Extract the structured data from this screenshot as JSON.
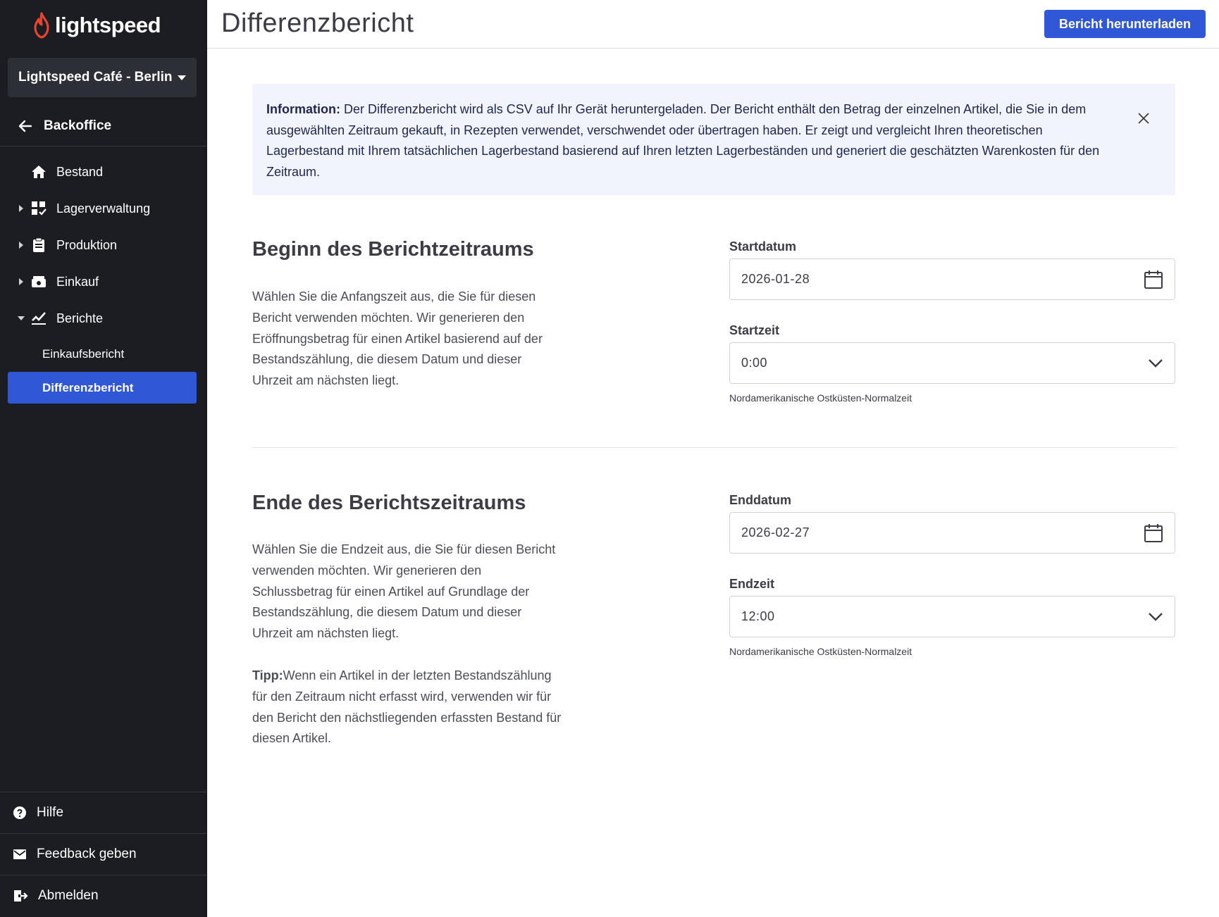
{
  "sidebar": {
    "logo_text": "lightspeed",
    "store_name": "Lightspeed Café - Berlin",
    "backoffice_label": "Backoffice",
    "nav": [
      {
        "label": "Bestand",
        "icon": "home-icon"
      },
      {
        "label": "Lagerverwaltung",
        "icon": "inventory-grid-icon"
      },
      {
        "label": "Produktion",
        "icon": "clipboard-icon"
      },
      {
        "label": "Einkauf",
        "icon": "cash-icon"
      },
      {
        "label": "Berichte",
        "icon": "chart-icon"
      }
    ],
    "sub_items": [
      "Einkaufsbericht",
      "Differenzbericht"
    ],
    "bottom": {
      "help": "Hilfe",
      "feedback": "Feedback geben",
      "logout": "Abmelden"
    }
  },
  "header": {
    "title": "Differenzbericht",
    "download_label": "Bericht herunterladen"
  },
  "info": {
    "prefix": "Information:",
    "text": " Der Differenzbericht wird als CSV auf Ihr Gerät heruntergeladen. Der Bericht enthält den Betrag der einzelnen Artikel, die Sie in dem ausgewählten Zeitraum gekauft, in Rezepten verwendet, verschwendet oder übertragen haben. Er zeigt und vergleicht Ihren theoretischen Lagerbestand mit Ihrem tatsächlichen Lagerbestand basierend auf Ihren letzten Lagerbeständen und generiert die geschätzten Warenkosten für den Zeitraum."
  },
  "start": {
    "title": "Beginn des Berichtzeitraums",
    "description": "Wählen Sie die Anfangszeit aus, die Sie für diesen Bericht verwenden möchten. Wir generieren den Eröffnungsbetrag für einen Artikel basierend auf der Bestandszählung, die diesem Datum und dieser Uhrzeit am nächsten liegt.",
    "date_label": "Startdatum",
    "date_value": "2026-01-28",
    "time_label": "Startzeit",
    "time_value": "0:00",
    "timezone": "Nordamerikanische Ostküsten-Normalzeit"
  },
  "end": {
    "title": "Ende des Berichtszeitraums",
    "description": "Wählen Sie die Endzeit aus, die Sie für diesen Bericht verwenden möchten. Wir generieren den Schlussbetrag für einen Artikel auf Grundlage der Bestandszählung, die diesem Datum und dieser Uhrzeit am nächsten liegt.",
    "tip_prefix": "Tipp:",
    "tip_text": "Wenn ein Artikel in der letzten Bestandszählung für den Zeitraum nicht erfasst wird, verwenden wir für den Bericht den nächstliegenden erfassten Bestand für diesen Artikel.",
    "date_label": "Enddatum",
    "date_value": "2026-02-27",
    "time_label": "Endzeit",
    "time_value": "12:00",
    "timezone": "Nordamerikanische Ostküsten-Normalzeit"
  },
  "colors": {
    "sidebar_bg": "#1b1d22",
    "accent": "#3057d5",
    "info_bg": "#f2f4fd",
    "logo_red": "#e8442e"
  }
}
